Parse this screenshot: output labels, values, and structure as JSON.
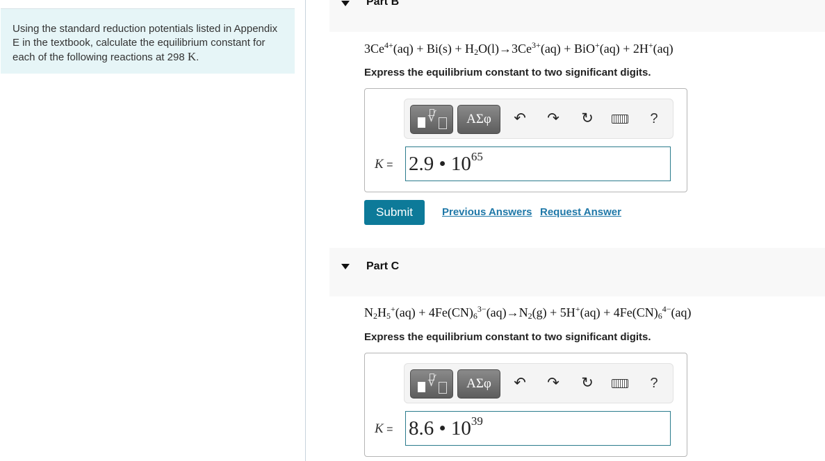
{
  "intro": {
    "text": "Using the standard reduction potentials listed in Appendix E in the textbook, calculate the equilibrium constant for each of the following reactions at 298",
    "unit": "K",
    "end": "."
  },
  "parts": [
    {
      "title": "Part B",
      "equation": "3Ce4+(aq) + Bi(s) + H2O(l) → 3Ce3+(aq) + BiO+(aq) + 2H+(aq)",
      "instruction": "Express the equilibrium constant to two significant digits.",
      "answer_label": "K =",
      "answer": {
        "mantissa": "2.9",
        "operator": "•",
        "base": "10",
        "exponent": "65"
      },
      "toolbar": {
        "templates_icon": "templates-icon",
        "greek_label": "ΑΣφ",
        "undo": "↶",
        "redo": "↷",
        "reset": "↻",
        "help": "?"
      },
      "actions": {
        "submit": "Submit",
        "previous": "Previous Answers",
        "request": "Request Answer"
      }
    },
    {
      "title": "Part C",
      "equation": "N2H5+(aq) + 4Fe(CN)6 3−(aq) → N2(g) + 5H+(aq) + 4Fe(CN)6 4−(aq)",
      "instruction": "Express the equilibrium constant to two significant digits.",
      "answer_label": "K =",
      "answer": {
        "mantissa": "8.6",
        "operator": "•",
        "base": "10",
        "exponent": "39"
      },
      "toolbar": {
        "templates_icon": "templates-icon",
        "greek_label": "ΑΣφ",
        "undo": "↶",
        "redo": "↷",
        "reset": "↻",
        "help": "?"
      }
    }
  ],
  "eq_tokens": {
    "b": [
      [
        "3Ce",
        "",
        ""
      ],
      [
        "",
        "4+",
        "sup"
      ],
      [
        "(aq) + Bi(s) + H",
        "",
        ""
      ],
      [
        "",
        "2",
        "sub"
      ],
      [
        "O(l)→3Ce",
        "",
        ""
      ],
      [
        "",
        "3+",
        "sup"
      ],
      [
        "(aq) + BiO",
        "",
        ""
      ],
      [
        "",
        "+",
        "sup"
      ],
      [
        "(aq) + 2H",
        "",
        ""
      ],
      [
        "",
        "+",
        "sup"
      ],
      [
        "(aq)",
        "",
        ""
      ]
    ],
    "c": [
      [
        "N",
        "",
        ""
      ],
      [
        "",
        "2",
        "sub"
      ],
      [
        "H",
        "",
        ""
      ],
      [
        "",
        "5",
        "sub"
      ],
      [
        "",
        "+",
        "sup"
      ],
      [
        "(aq) + 4Fe(CN)",
        "",
        ""
      ],
      [
        "",
        "6",
        "sub"
      ],
      [
        "",
        "3−",
        "sup"
      ],
      [
        "(aq)→N",
        "",
        ""
      ],
      [
        "",
        "2",
        "sub"
      ],
      [
        "(g) + 5H",
        "",
        ""
      ],
      [
        "",
        "+",
        "sup"
      ],
      [
        "(aq) + 4Fe(CN)",
        "",
        ""
      ],
      [
        "",
        "6",
        "sub"
      ],
      [
        "",
        "4−",
        "sup"
      ],
      [
        "(aq)",
        "",
        ""
      ]
    ]
  },
  "colors": {
    "accent": "#0d7a99",
    "link": "#1f78a8",
    "intro_bg": "#e6f5f7",
    "input_border": "#2a7b8c"
  }
}
